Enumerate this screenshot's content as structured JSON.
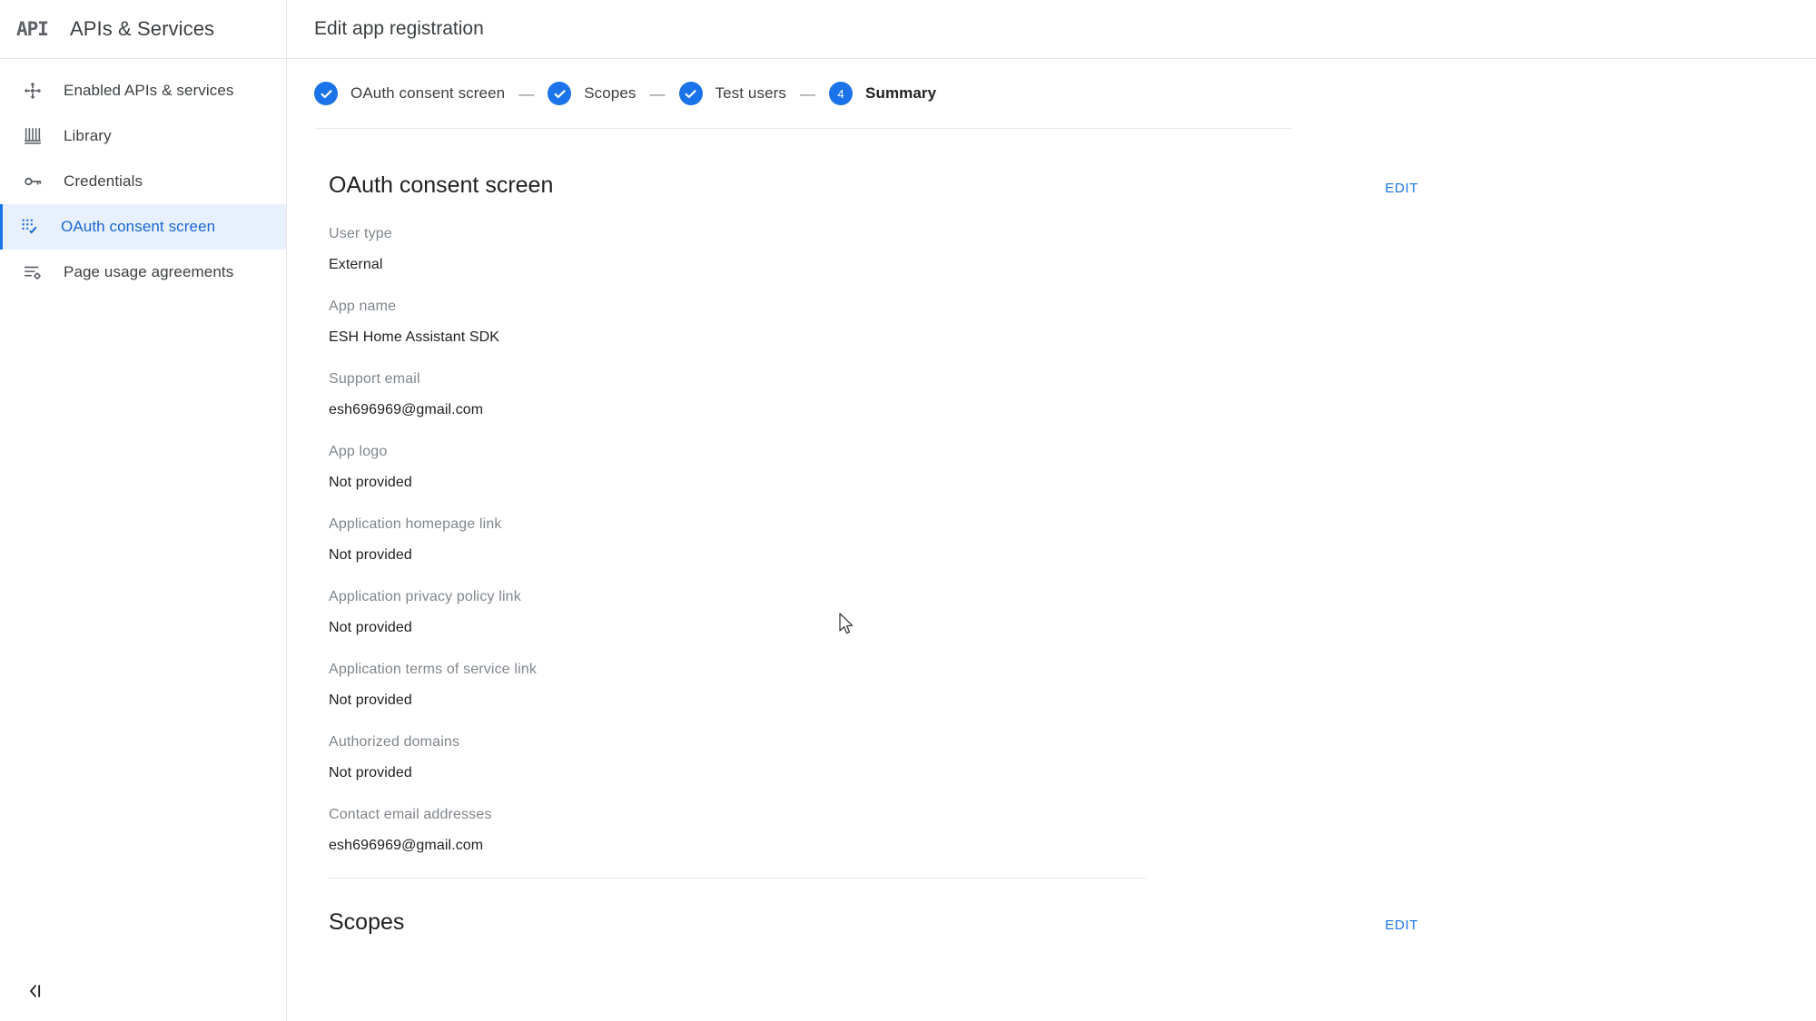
{
  "topbar": {
    "logo_text": "API",
    "brand_title": "APIs & Services",
    "page_title": "Edit app registration"
  },
  "sidebar": {
    "items": [
      {
        "label": "Enabled APIs & services",
        "icon": "enabled-apis-icon",
        "active": false
      },
      {
        "label": "Library",
        "icon": "library-icon",
        "active": false
      },
      {
        "label": "Credentials",
        "icon": "key-icon",
        "active": false
      },
      {
        "label": "OAuth consent screen",
        "icon": "oauth-consent-icon",
        "active": true
      },
      {
        "label": "Page usage agreements",
        "icon": "page-usage-icon",
        "active": false
      }
    ],
    "collapse_icon": "collapse-sidebar-icon"
  },
  "stepper": {
    "separator": "—",
    "steps": [
      {
        "label": "OAuth consent screen",
        "state": "complete",
        "marker": "check"
      },
      {
        "label": "Scopes",
        "state": "complete",
        "marker": "check"
      },
      {
        "label": "Test users",
        "state": "complete",
        "marker": "check"
      },
      {
        "label": "Summary",
        "state": "current",
        "marker": "4"
      }
    ]
  },
  "sections": [
    {
      "title": "OAuth consent screen",
      "edit_label": "EDIT",
      "fields": [
        {
          "label": "User type",
          "value": "External"
        },
        {
          "label": "App name",
          "value": "ESH Home Assistant SDK"
        },
        {
          "label": "Support email",
          "value": "esh696969@gmail.com"
        },
        {
          "label": "App logo",
          "value": "Not provided"
        },
        {
          "label": "Application homepage link",
          "value": "Not provided"
        },
        {
          "label": "Application privacy policy link",
          "value": "Not provided"
        },
        {
          "label": "Application terms of service link",
          "value": "Not provided"
        },
        {
          "label": "Authorized domains",
          "value": "Not provided"
        },
        {
          "label": "Contact email addresses",
          "value": "esh696969@gmail.com"
        }
      ]
    },
    {
      "title": "Scopes",
      "edit_label": "EDIT",
      "fields": []
    }
  ],
  "colors": {
    "accent": "#1a73e8",
    "link": "#1a73e8",
    "active_nav_bg": "#e8f0fe",
    "active_nav_text": "#1967d2",
    "label_text": "#80868b",
    "value_text": "#202124",
    "border": "#e4e6e9"
  }
}
